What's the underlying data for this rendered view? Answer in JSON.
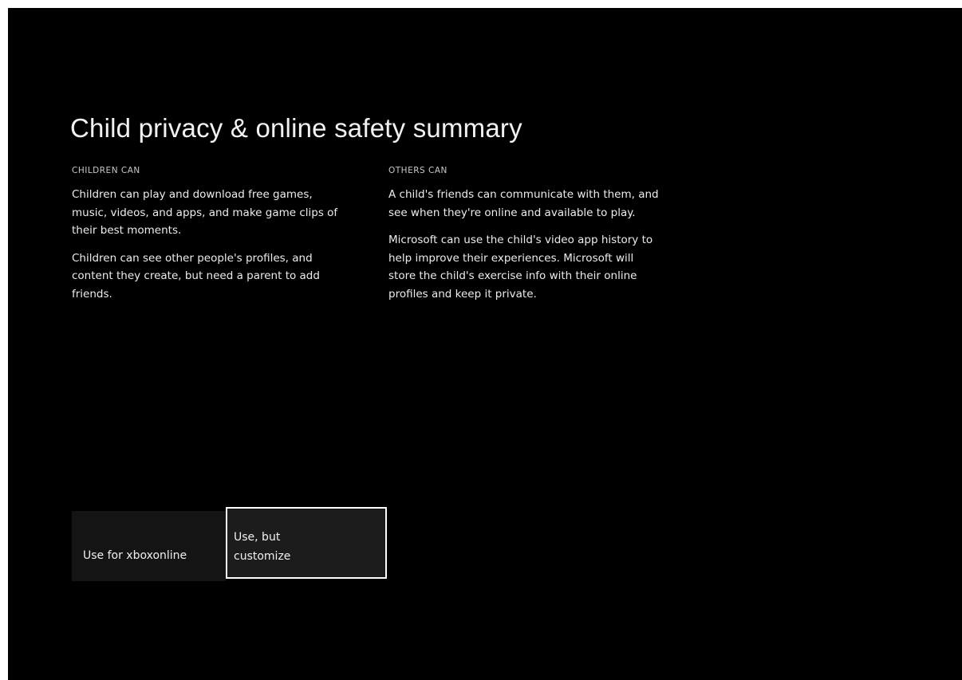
{
  "title": "Child privacy & online safety summary",
  "columns": [
    {
      "heading": "CHILDREN CAN",
      "paragraphs": [
        "Children can play and download free games, music, videos, and apps, and make game clips of their best moments.",
        "Children can see other people's profiles, and content they create, but need a parent to add friends."
      ]
    },
    {
      "heading": "OTHERS CAN",
      "paragraphs": [
        "A child's friends can communicate with them, and see when they're online and available to play.",
        "Microsoft can use the child's video app history to help improve their experiences. Microsoft will store the child's exercise info with their online profiles and keep it private."
      ]
    }
  ],
  "buttons": {
    "use_default": "Use for xboxonline",
    "use_customize": "Use, but customize"
  },
  "colors": {
    "background": "#000000",
    "text": "#ffffff",
    "button_background": "#1a1a1a",
    "focus_border": "#ffffff"
  }
}
